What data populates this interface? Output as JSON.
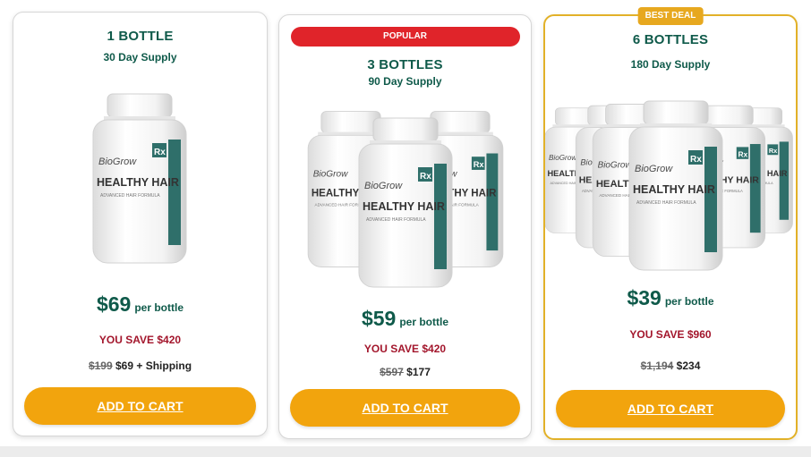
{
  "colors": {
    "brand_green": "#0f5a4a",
    "save_red": "#a3162c",
    "cta_orange": "#f2a40d",
    "popular_red": "#e0242a",
    "best_gold": "#e7a81f",
    "label_teal": "#2f6f6a"
  },
  "product": {
    "brand": "BioGrow",
    "brand_mark": "Rx",
    "name": "HEALTHY HAIR",
    "tagline": "ADVANCED HAIR FORMULA"
  },
  "offers": [
    {
      "quantity": "1 BOTTLE",
      "supply": "30 Day Supply",
      "badge": "",
      "price": "$69",
      "per": "per bottle",
      "savings": "YOU SAVE $420",
      "old_total": "$199",
      "new_total": "$69 + Shipping",
      "cta": "ADD TO CART",
      "bottle_count": 1
    },
    {
      "quantity": "3 BOTTLES",
      "supply": "90 Day Supply",
      "badge": "POPULAR",
      "price": "$59",
      "per": "per bottle",
      "savings": "YOU SAVE $420",
      "old_total": "$597",
      "new_total": "$177",
      "cta": "ADD TO CART",
      "bottle_count": 3
    },
    {
      "quantity": "6 BOTTLES",
      "supply": "180 Day Supply",
      "badge": "BEST DEAL",
      "price": "$39",
      "per": "per bottle",
      "savings": "YOU SAVE $960",
      "old_total": "$1,194",
      "new_total": "$234",
      "cta": "ADD TO CART",
      "bottle_count": 6
    }
  ]
}
